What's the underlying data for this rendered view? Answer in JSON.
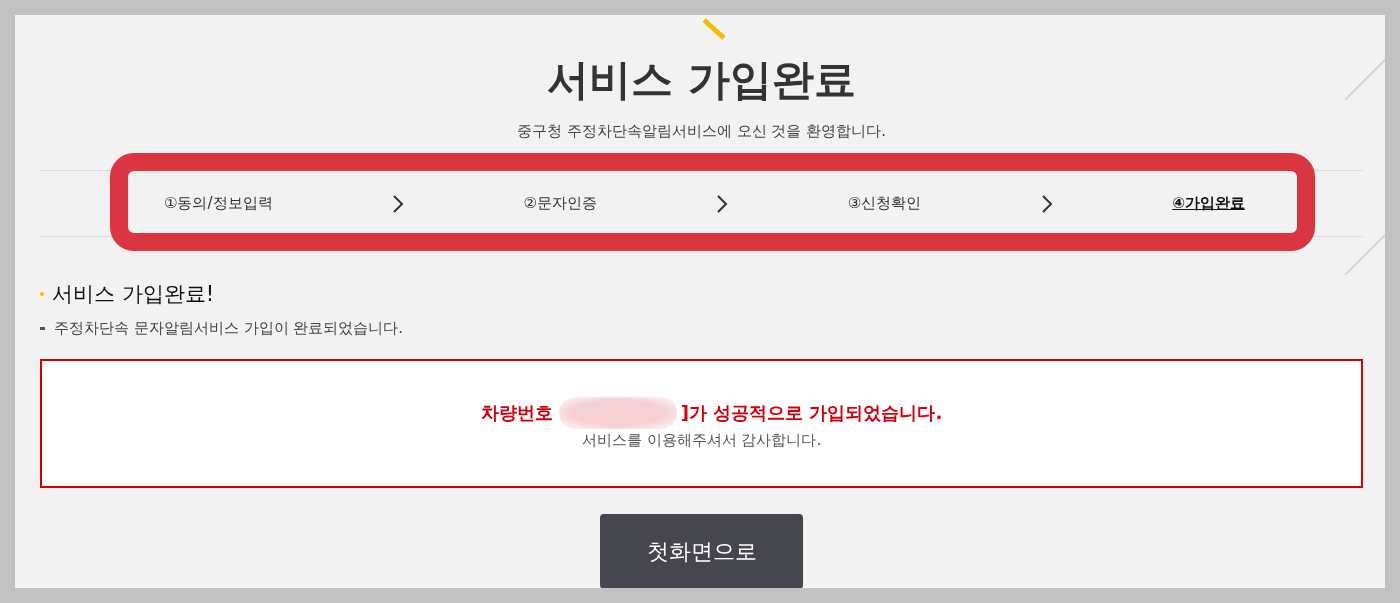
{
  "page": {
    "title": "서비스 가입완료",
    "subtitle": "중구청 주정차단속알림서비스에 오신 것을 환영합니다."
  },
  "steps": [
    {
      "label": "①동의/정보입력",
      "selected": false
    },
    {
      "label": "②문자인증",
      "selected": false
    },
    {
      "label": "③신청확인",
      "selected": false
    },
    {
      "label": "④가입완료",
      "selected": true
    }
  ],
  "section": {
    "heading": "서비스 가입완료!",
    "description": "주정차단속 문자알림서비스 가입이 완료되었습니다."
  },
  "result": {
    "message_start": "차량번호",
    "message_end": "]가 성공적으로 가입되었습니다.",
    "thanks": "서비스를 이용해주셔서 감사합니다."
  },
  "buttons": [
    {
      "label": "첫화면으로"
    }
  ]
}
